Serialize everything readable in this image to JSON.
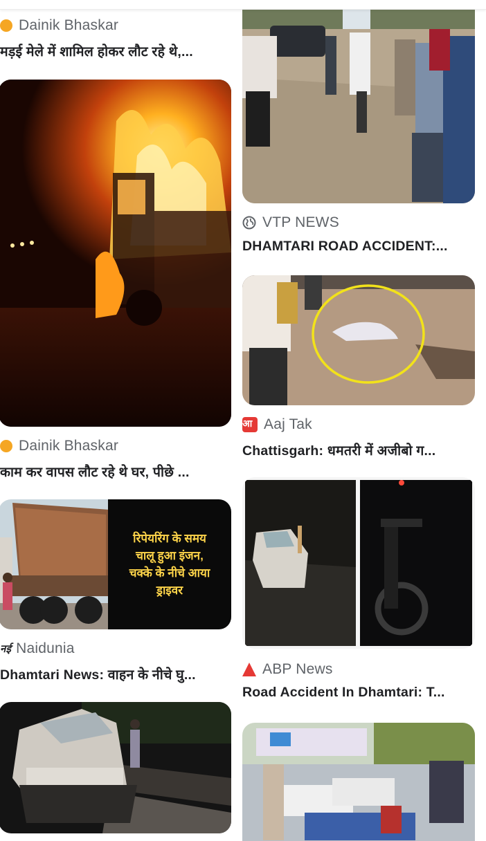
{
  "feed": {
    "left": [
      {
        "source": "Dainik Bhaskar",
        "source_icon": "dot-icon",
        "headline": "मड़ई मेले में शामिल होकर लौट रहे थे,..."
      },
      {
        "image_icon": "burning-truck-image",
        "source": "Dainik Bhaskar",
        "source_icon": "dot-icon",
        "headline": "काम कर वापस लौट रहे थे घर, पीछे ..."
      },
      {
        "image_icon": "dump-truck-image",
        "image_caption": "रिपेयरिंग के समय\nचालू हुआ इंजन,\nचक्के के नीचे आया\nड्राइवर",
        "source": "Naidunia",
        "source_icon_text": "नई",
        "headline": "Dhamtari News: वाहन के नीचे घु..."
      },
      {
        "image_icon": "crashed-car-image"
      }
    ],
    "right": [
      {
        "image_icon": "crowd-on-road-image",
        "source": "VTP NEWS",
        "source_icon": "globe-icon",
        "headline": "DHAMTARI ROAD ACCIDENT:..."
      },
      {
        "image_icon": "covered-body-image",
        "source": "Aaj Tak",
        "source_icon_text": "आ",
        "headline": "Chattisgarh: धमतरी में अजीबो ग..."
      },
      {
        "image_icon": "night-accident-collage-image",
        "source": "ABP News",
        "source_icon": "abp-logo-icon",
        "headline": "Road Accident In Dhamtari: T..."
      },
      {
        "image_icon": "hospital-ward-image"
      }
    ]
  },
  "colors": {
    "source_dot": "#f5a623",
    "brand_red": "#e53935",
    "overlay_text": "#ffd54a"
  }
}
